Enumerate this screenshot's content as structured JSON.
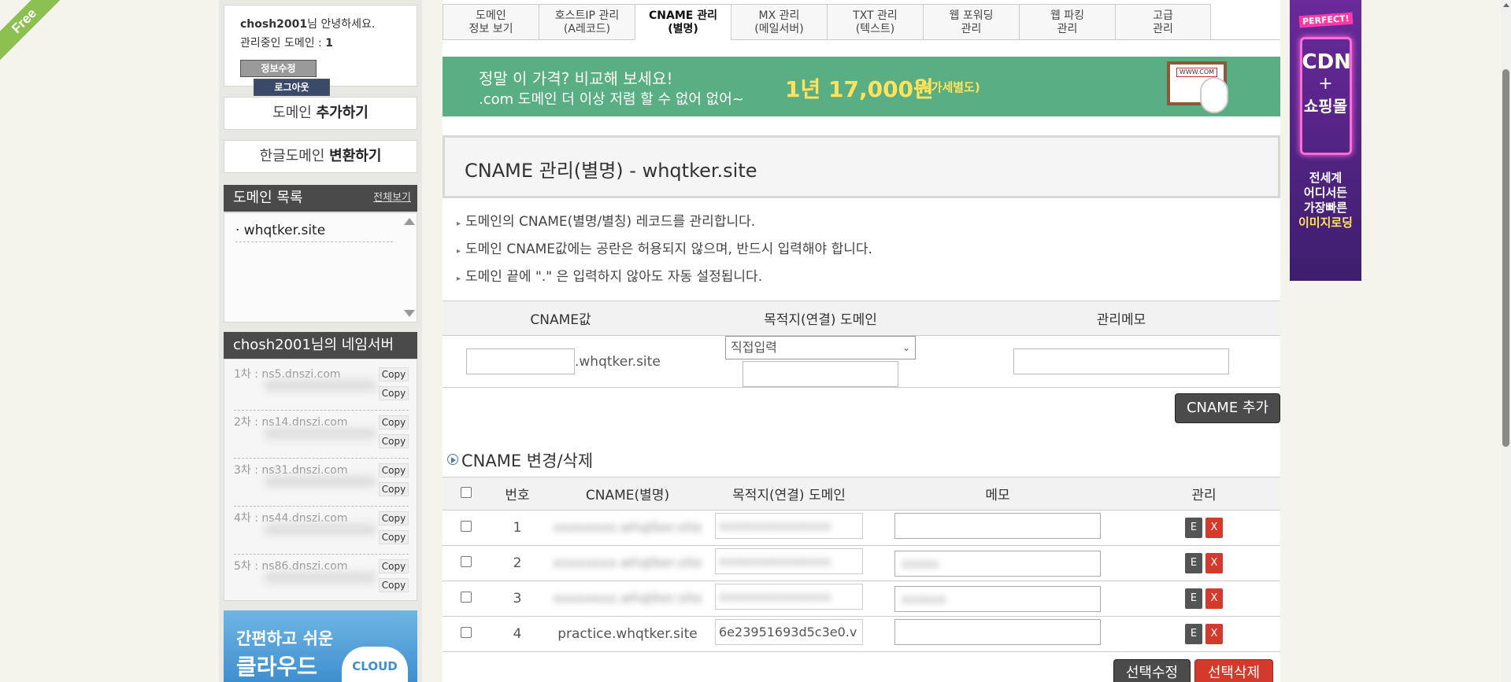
{
  "ribbon": "Free",
  "user": {
    "name": "chosh2001",
    "greeting": "님 안녕하세요.",
    "managed_label": "관리중인 도메인 :",
    "managed_count": "1",
    "edit_button": "정보수정",
    "logout_button": "로그아웃"
  },
  "sidebar": {
    "add_domain_pre": "도메인 ",
    "add_domain_bold": "추가하기",
    "convert_pre": "한글도메인 ",
    "convert_bold": "변환하기",
    "domain_list_title": "도메인 목록",
    "view_all": "전체보기",
    "domains": [
      "· whqtker.site"
    ],
    "ns_title_user": "chosh2001",
    "ns_title_suffix": "님의 네임서버",
    "nameservers": [
      {
        "label": "1차 : ns5.dnszi.com",
        "copy1": "Copy",
        "copy2": "Copy"
      },
      {
        "label": "2차 : ns14.dnszi.com",
        "copy1": "Copy",
        "copy2": "Copy"
      },
      {
        "label": "3차 : ns31.dnszi.com",
        "copy1": "Copy",
        "copy2": "Copy"
      },
      {
        "label": "4차 : ns44.dnszi.com",
        "copy1": "Copy",
        "copy2": "Copy"
      },
      {
        "label": "5차 : ns86.dnszi.com",
        "copy1": "Copy",
        "copy2": "Copy"
      }
    ],
    "cloud_line1": "간편하고 쉬운",
    "cloud_line2": "클라우드",
    "cloud_badge": "CLOUD"
  },
  "tabs": [
    {
      "label": "도메인\n정보 보기"
    },
    {
      "label": "호스트IP 관리\n(A레코드)"
    },
    {
      "label": "CNAME 관리\n(별명)"
    },
    {
      "label": "MX 관리\n(메일서버)"
    },
    {
      "label": "TXT 관리\n(텍스트)"
    },
    {
      "label": "웹 포워딩\n관리"
    },
    {
      "label": "웹 파킹\n관리"
    },
    {
      "label": "고급\n관리"
    }
  ],
  "banner": {
    "line1": "정말 이 가격? 비교해 보세요!",
    "line2": ".com 도메인 더 이상 저렴 할 수 없어 없어~",
    "price": "1년 17,000원",
    "vat": "(부가세별도)",
    "screen_text": "WWW.COM"
  },
  "page_title": "CNAME 관리(별명) - whqtker.site",
  "notes": [
    "도메인의 CNAME(별명/별칭) 레코드를 관리합니다.",
    "도메인 CNAME값에는 공란은 허용되지 않으며, 반드시 입력해야 합니다.",
    "도메인 끝에 \".\" 은 입력하지 않아도 자동 설정됩니다."
  ],
  "add_form": {
    "col_cname": "CNAME값",
    "col_target": "목적지(연결) 도메인",
    "col_memo": "관리메모",
    "suffix": ".whqtker.site",
    "select_value": "직접입력",
    "add_button": "CNAME 추가"
  },
  "list_section": {
    "title": "CNAME 변경/삭제",
    "headers": {
      "num": "번호",
      "cname": "CNAME(별명)",
      "target": "목적지(연결) 도메인",
      "memo": "메모",
      "manage": "관리"
    },
    "rows": [
      {
        "num": "1",
        "cname": "",
        "target": "",
        "memo": ""
      },
      {
        "num": "2",
        "cname": "",
        "target": "",
        "memo": ""
      },
      {
        "num": "3",
        "cname": "",
        "target": "",
        "memo": ""
      },
      {
        "num": "4",
        "cname": "practice.whqtker.site",
        "target": "6e23951693d5c3e0.v",
        "memo": ""
      }
    ],
    "edit_glyph": "E",
    "delete_glyph": "X",
    "bulk_edit": "선택수정",
    "bulk_delete": "선택삭제"
  },
  "ad": {
    "tag": "PERFECT!",
    "neon1": "CDN",
    "neon2": "+",
    "neon3": "쇼핑몰",
    "slogan1": "전세계",
    "slogan2": "어디서든",
    "slogan3": "가장빠른",
    "slogan4": "이미지로딩"
  }
}
